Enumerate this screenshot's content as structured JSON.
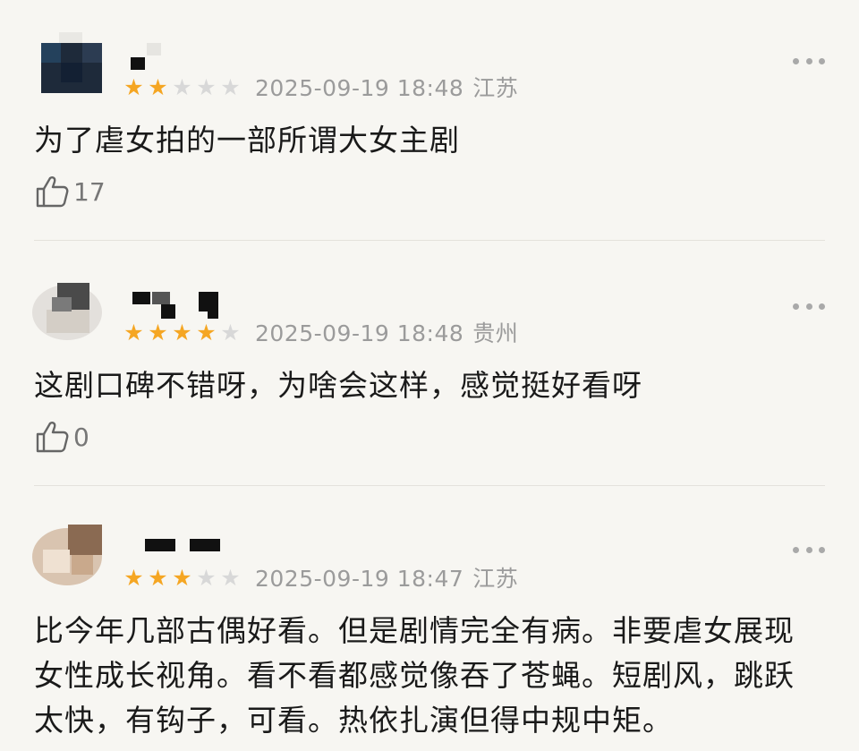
{
  "comments": [
    {
      "rating": 2,
      "time": "2025-09-19 18:48",
      "location": "江苏",
      "text": "为了虐女拍的一部所谓大女主剧",
      "likes": "17"
    },
    {
      "rating": 4,
      "time": "2025-09-19 18:48",
      "location": "贵州",
      "text": "这剧口碑不错呀，为啥会这样，感觉挺好看呀",
      "likes": "0"
    },
    {
      "rating": 3,
      "time": "2025-09-19 18:47",
      "location": "江苏",
      "text": "比今年几部古偶好看。但是剧情完全有病。非要虐女展现女性成长视角。看不看都感觉像吞了苍蝇。短剧风，跳跃太快，有钩子，可看。热依扎演但得中规中矩。"
    }
  ],
  "colors": {
    "star_on": "#f5a623",
    "star_off": "#d8d8d8",
    "meta_gray": "#9b9b9b",
    "background": "#f7f6f2"
  },
  "icons": {
    "like": "thumbs-up-icon",
    "more": "more-dots-icon",
    "star": "star-icon"
  }
}
